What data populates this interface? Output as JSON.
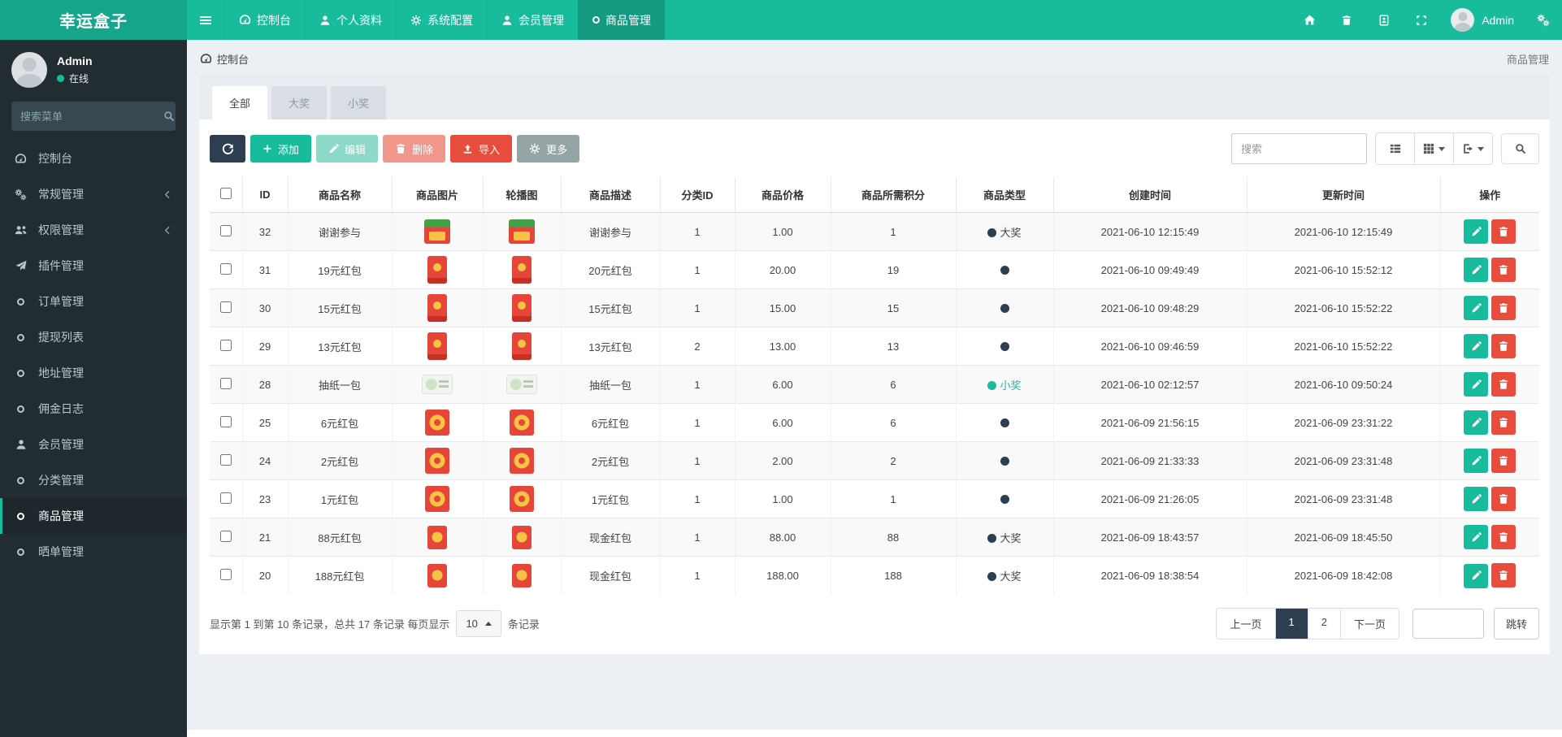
{
  "colors": {
    "accent": "#18bc9c",
    "dark": "#2c3e50",
    "danger": "#e74c3c",
    "sidebar_bg": "#222d32",
    "page_bg": "#ecf0f5"
  },
  "navbar": {
    "brand": "幸运盒子",
    "menu": [
      {
        "label": "控制台",
        "icon": "dashboard-icon",
        "active": false
      },
      {
        "label": "个人资料",
        "icon": "user-icon",
        "active": false
      },
      {
        "label": "系统配置",
        "icon": "gear-icon",
        "active": false
      },
      {
        "label": "会员管理",
        "icon": "user-icon",
        "active": false
      },
      {
        "label": "商品管理",
        "icon": "circle-icon",
        "active": true
      }
    ],
    "right_icons": [
      {
        "name": "home-icon"
      },
      {
        "name": "trash-icon"
      },
      {
        "name": "log-book-icon"
      },
      {
        "name": "fullscreen-icon"
      }
    ],
    "user_name": "Admin"
  },
  "sidebar": {
    "user_name": "Admin",
    "user_status": "在线",
    "search_placeholder": "搜索菜单",
    "items": [
      {
        "label": "控制台",
        "icon": "dashboard-icon",
        "active": false,
        "has_arrow": false
      },
      {
        "label": "常规管理",
        "icon": "gears-icon",
        "active": false,
        "has_arrow": true
      },
      {
        "label": "权限管理",
        "icon": "users-icon",
        "active": false,
        "has_arrow": true
      },
      {
        "label": "插件管理",
        "icon": "paper-plane-icon",
        "active": false,
        "has_arrow": false
      },
      {
        "label": "订单管理",
        "icon": "circle-icon",
        "active": false,
        "has_arrow": false
      },
      {
        "label": "提现列表",
        "icon": "circle-icon",
        "active": false,
        "has_arrow": false
      },
      {
        "label": "地址管理",
        "icon": "circle-icon",
        "active": false,
        "has_arrow": false
      },
      {
        "label": "佣金日志",
        "icon": "circle-icon",
        "active": false,
        "has_arrow": false
      },
      {
        "label": "会员管理",
        "icon": "user-icon",
        "active": false,
        "has_arrow": false
      },
      {
        "label": "分类管理",
        "icon": "circle-icon",
        "active": false,
        "has_arrow": false
      },
      {
        "label": "商品管理",
        "icon": "circle-icon",
        "active": true,
        "has_arrow": false
      },
      {
        "label": "晒单管理",
        "icon": "circle-icon",
        "active": false,
        "has_arrow": false
      }
    ]
  },
  "content": {
    "breadcrumb": "控制台",
    "page_title": "商品管理",
    "tabs": [
      {
        "label": "全部",
        "active": true
      },
      {
        "label": "大奖",
        "active": false
      },
      {
        "label": "小奖",
        "active": false
      }
    ],
    "toolbar": {
      "add": "添加",
      "edit": "编辑",
      "delete": "删除",
      "import": "导入",
      "more": "更多",
      "search_placeholder": "搜索"
    },
    "table": {
      "columns": [
        "ID",
        "商品名称",
        "商品图片",
        "轮播图",
        "商品描述",
        "分类ID",
        "商品价格",
        "商品所需积分",
        "商品类型",
        "创建时间",
        "更新时间",
        "操作"
      ],
      "rows": [
        {
          "id": "32",
          "name": "谢谢参与",
          "image": "gift-box",
          "description": "谢谢参与",
          "category_id": "1",
          "price": "1.00",
          "points": "1",
          "type": {
            "label": "大奖",
            "variant": "dark"
          },
          "created": "2021-06-10 12:15:49",
          "updated": "2021-06-10 12:15:49"
        },
        {
          "id": "31",
          "name": "19元红包",
          "image": "red-envelope",
          "description": "20元红包",
          "category_id": "1",
          "price": "20.00",
          "points": "19",
          "type": {
            "label": "",
            "variant": "dark"
          },
          "created": "2021-06-10 09:49:49",
          "updated": "2021-06-10 15:52:12"
        },
        {
          "id": "30",
          "name": "15元红包",
          "image": "red-envelope",
          "description": "15元红包",
          "category_id": "1",
          "price": "15.00",
          "points": "15",
          "type": {
            "label": "",
            "variant": "dark"
          },
          "created": "2021-06-10 09:48:29",
          "updated": "2021-06-10 15:52:22"
        },
        {
          "id": "29",
          "name": "13元红包",
          "image": "red-envelope",
          "description": "13元红包",
          "category_id": "2",
          "price": "13.00",
          "points": "13",
          "type": {
            "label": "",
            "variant": "dark"
          },
          "created": "2021-06-10 09:46:59",
          "updated": "2021-06-10 15:52:22"
        },
        {
          "id": "28",
          "name": "抽纸一包",
          "image": "tissue-pack",
          "description": "抽纸一包",
          "category_id": "1",
          "price": "6.00",
          "points": "6",
          "type": {
            "label": "小奖",
            "variant": "green"
          },
          "created": "2021-06-10 02:12:57",
          "updated": "2021-06-10 09:50:24"
        },
        {
          "id": "25",
          "name": "6元红包",
          "image": "red-packet",
          "description": "6元红包",
          "category_id": "1",
          "price": "6.00",
          "points": "6",
          "type": {
            "label": "",
            "variant": "dark"
          },
          "created": "2021-06-09 21:56:15",
          "updated": "2021-06-09 23:31:22"
        },
        {
          "id": "24",
          "name": "2元红包",
          "image": "red-packet",
          "description": "2元红包",
          "category_id": "1",
          "price": "2.00",
          "points": "2",
          "type": {
            "label": "",
            "variant": "dark"
          },
          "created": "2021-06-09 21:33:33",
          "updated": "2021-06-09 23:31:48"
        },
        {
          "id": "23",
          "name": "1元红包",
          "image": "red-packet",
          "description": "1元红包",
          "category_id": "1",
          "price": "1.00",
          "points": "1",
          "type": {
            "label": "",
            "variant": "dark"
          },
          "created": "2021-06-09 21:26:05",
          "updated": "2021-06-09 23:31:48"
        },
        {
          "id": "21",
          "name": "88元红包",
          "image": "red-envelope-small",
          "description": "现金红包",
          "category_id": "1",
          "price": "88.00",
          "points": "88",
          "type": {
            "label": "大奖",
            "variant": "dark"
          },
          "created": "2021-06-09 18:43:57",
          "updated": "2021-06-09 18:45:50"
        },
        {
          "id": "20",
          "name": "188元红包",
          "image": "red-envelope-small",
          "description": "现金红包",
          "category_id": "1",
          "price": "188.00",
          "points": "188",
          "type": {
            "label": "大奖",
            "variant": "dark"
          },
          "created": "2021-06-09 18:38:54",
          "updated": "2021-06-09 18:42:08"
        }
      ]
    },
    "pagination": {
      "info_prefix": "显示第 1 到第 10 条记录，总共 17 条记录 每页显示",
      "page_size": "10",
      "info_suffix": "条记录",
      "prev_label": "上一页",
      "pages": [
        "1",
        "2"
      ],
      "active_page": "1",
      "next_label": "下一页",
      "jump_label": "跳转"
    }
  }
}
